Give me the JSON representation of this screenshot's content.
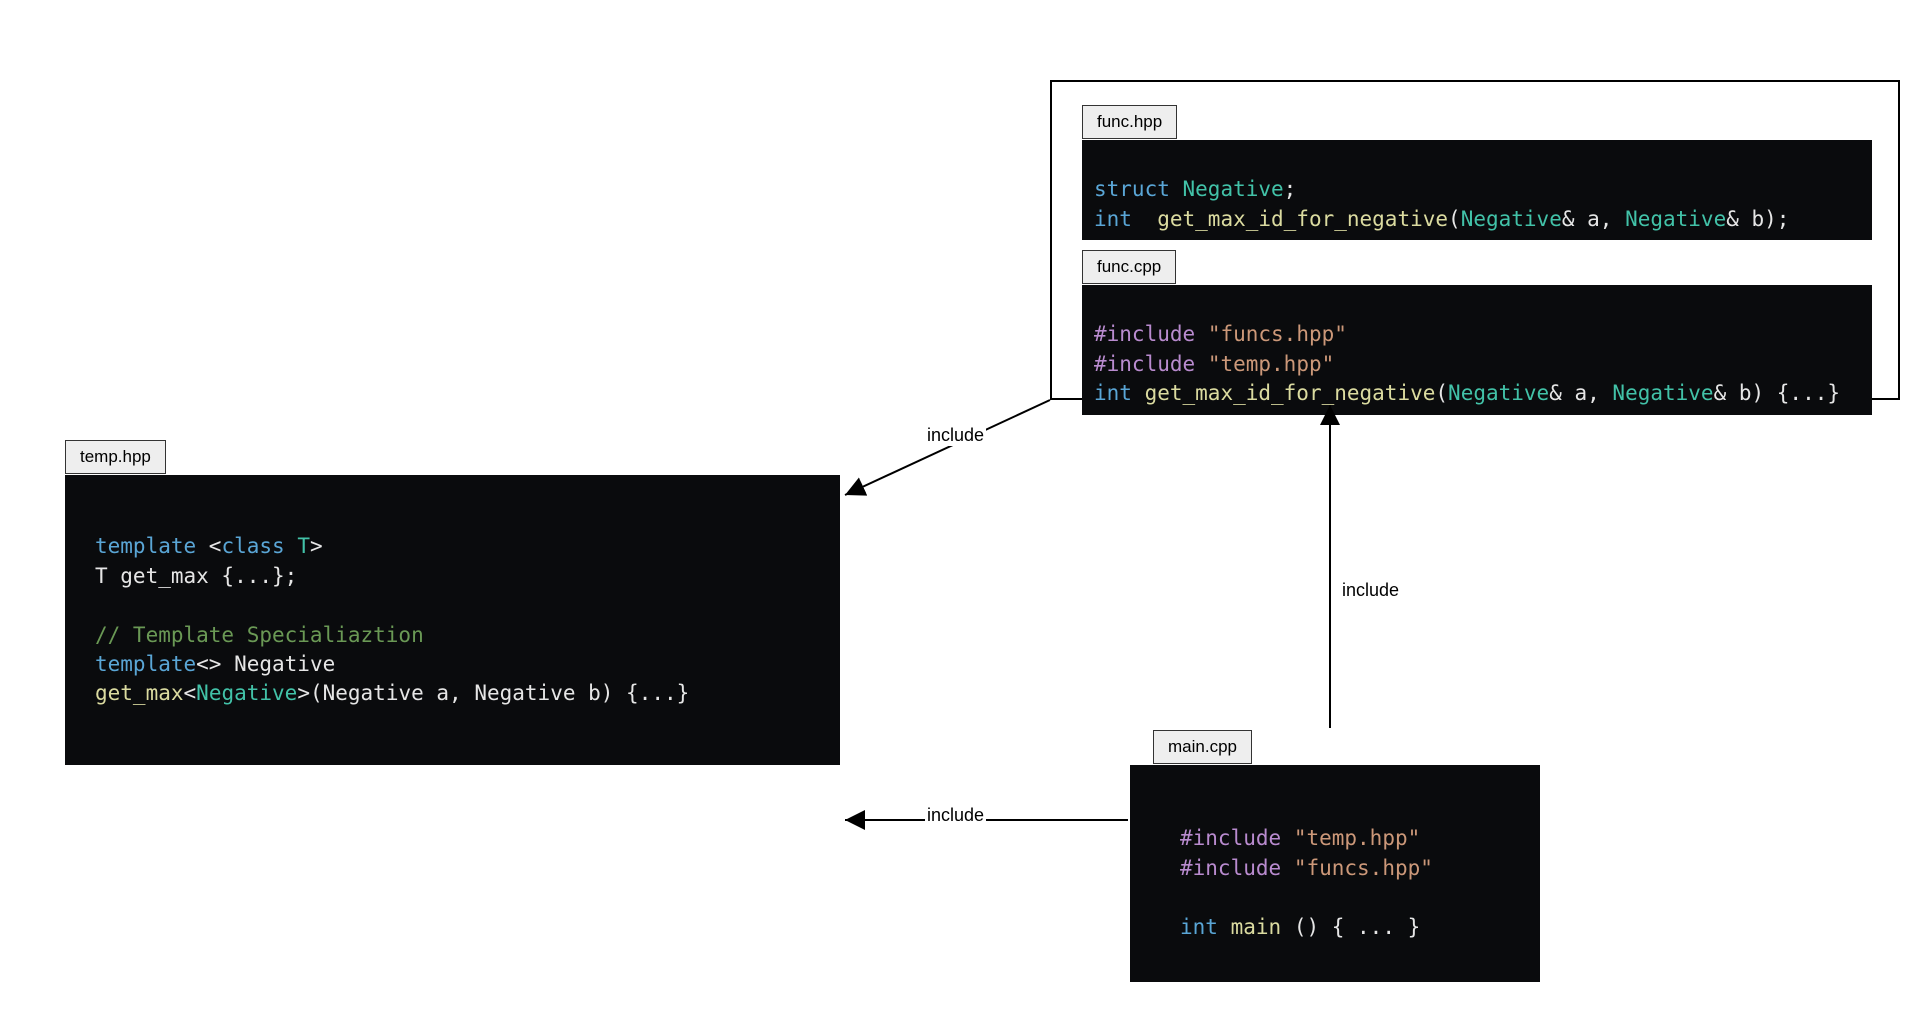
{
  "files": {
    "temp_hpp": {
      "label": "temp.hpp"
    },
    "func_hpp": {
      "label": "func.hpp"
    },
    "func_cpp": {
      "label": "func.cpp"
    },
    "main_cpp": {
      "label": "main.cpp"
    }
  },
  "edges": {
    "a": "include",
    "b": "include",
    "c": "include"
  },
  "code": {
    "temp_hpp": {
      "l1p1": "template",
      "l1p2": " <",
      "l1p3": "class",
      "l1p4": " ",
      "l1p5": "T",
      "l1p6": ">",
      "l2p1": "T get_max {...};",
      "l3": "",
      "l4": "// Template Specialiaztion",
      "l5p1": "template",
      "l5p2": "<> Negative",
      "l6p1": "get_max",
      "l6p2": "<",
      "l6p3": "Negative",
      "l6p4": ">(Negative a, Negative b) {...}"
    },
    "func_hpp": {
      "l1p1": "struct",
      "l1p2": " ",
      "l1p3": "Negative",
      "l1p4": ";",
      "l2p1": "int",
      "l2p2": "  ",
      "l2p3": "get_max_id_for_negative",
      "l2p4": "(",
      "l2p5": "Negative",
      "l2p6": "& a, ",
      "l2p7": "Negative",
      "l2p8": "& b);"
    },
    "func_cpp": {
      "l1p1": "#include",
      "l1p2": " ",
      "l1p3": "\"funcs.hpp\"",
      "l2p1": "#include",
      "l2p2": " ",
      "l2p3": "\"temp.hpp\"",
      "l3p1": "int",
      "l3p2": " ",
      "l3p3": "get_max_id_for_negative",
      "l3p4": "(",
      "l3p5": "Negative",
      "l3p6": "& a, ",
      "l3p7": "Negative",
      "l3p8": "& b) {...}"
    },
    "main_cpp": {
      "l1p1": "#include",
      "l1p2": " ",
      "l1p3": "\"temp.hpp\"",
      "l2p1": "#include",
      "l2p2": " ",
      "l2p3": "\"funcs.hpp\"",
      "l3": "",
      "l4p1": "int",
      "l4p2": " ",
      "l4p3": "main",
      "l4p4": " () { ... }"
    }
  }
}
